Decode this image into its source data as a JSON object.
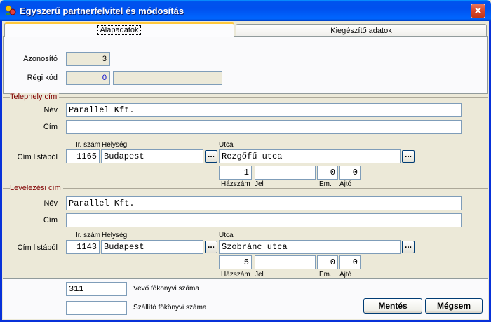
{
  "window": {
    "title": "Egyszerű partnerfelvitel és módosítás",
    "close_glyph": "✕"
  },
  "tabs": [
    {
      "label": "Alapadatok",
      "active": true
    },
    {
      "label": "Kiegészítő adatok",
      "active": false
    }
  ],
  "top": {
    "azonosito_label": "Azonosító",
    "azonosito_value": "3",
    "regi_kod_label": "Régi kód",
    "regi_kod_value": "0",
    "regi_kod_extra": ""
  },
  "telephely": {
    "section_title": "Telephely cím",
    "nev_label": "Név",
    "nev_value": "Parallel Kft.",
    "cim_label": "Cím",
    "cim_value": "",
    "cim_listabol_label": "Cím listából",
    "irszam_label": "Ir. szám",
    "irszam_value": "1165",
    "helyseg_label": "Helység",
    "helyseg_value": "Budapest",
    "utca_label": "Utca",
    "utca_value": "Rezgőfű utca",
    "hazszam_label": "Házszám",
    "hazszam_value": "1",
    "jel_label": "Jel",
    "jel_value": "",
    "em_label": "Em.",
    "em_value": "0",
    "ajto_label": "Ajtó",
    "ajto_value": "0",
    "browse_label": "..."
  },
  "levelezesi": {
    "section_title": "Levelezési cím",
    "nev_label": "Név",
    "nev_value": "Parallel Kft.",
    "cim_label": "Cím",
    "cim_value": "",
    "cim_listabol_label": "Cím listából",
    "irszam_label": "Ir. szám",
    "irszam_value": "1143",
    "helyseg_label": "Helység",
    "helyseg_value": "Budapest",
    "utca_label": "Utca",
    "utca_value": "Szobránc utca",
    "hazszam_label": "Házszám",
    "hazszam_value": "5",
    "jel_label": "Jel",
    "jel_value": "",
    "em_label": "Em.",
    "em_value": "0",
    "ajto_label": "Ajtó",
    "ajto_value": "0",
    "browse_label": "..."
  },
  "bottom": {
    "vevo_value": "311",
    "vevo_label": "Vevő főkönyvi száma",
    "szallito_value": "",
    "szallito_label": "Szállító főkönyvi száma",
    "save_label": "Mentés",
    "cancel_label": "Mégsem"
  },
  "colors": {
    "titlebar": "#0053EE",
    "section_title": "#800000",
    "window_bg": "#ECE9D8"
  }
}
